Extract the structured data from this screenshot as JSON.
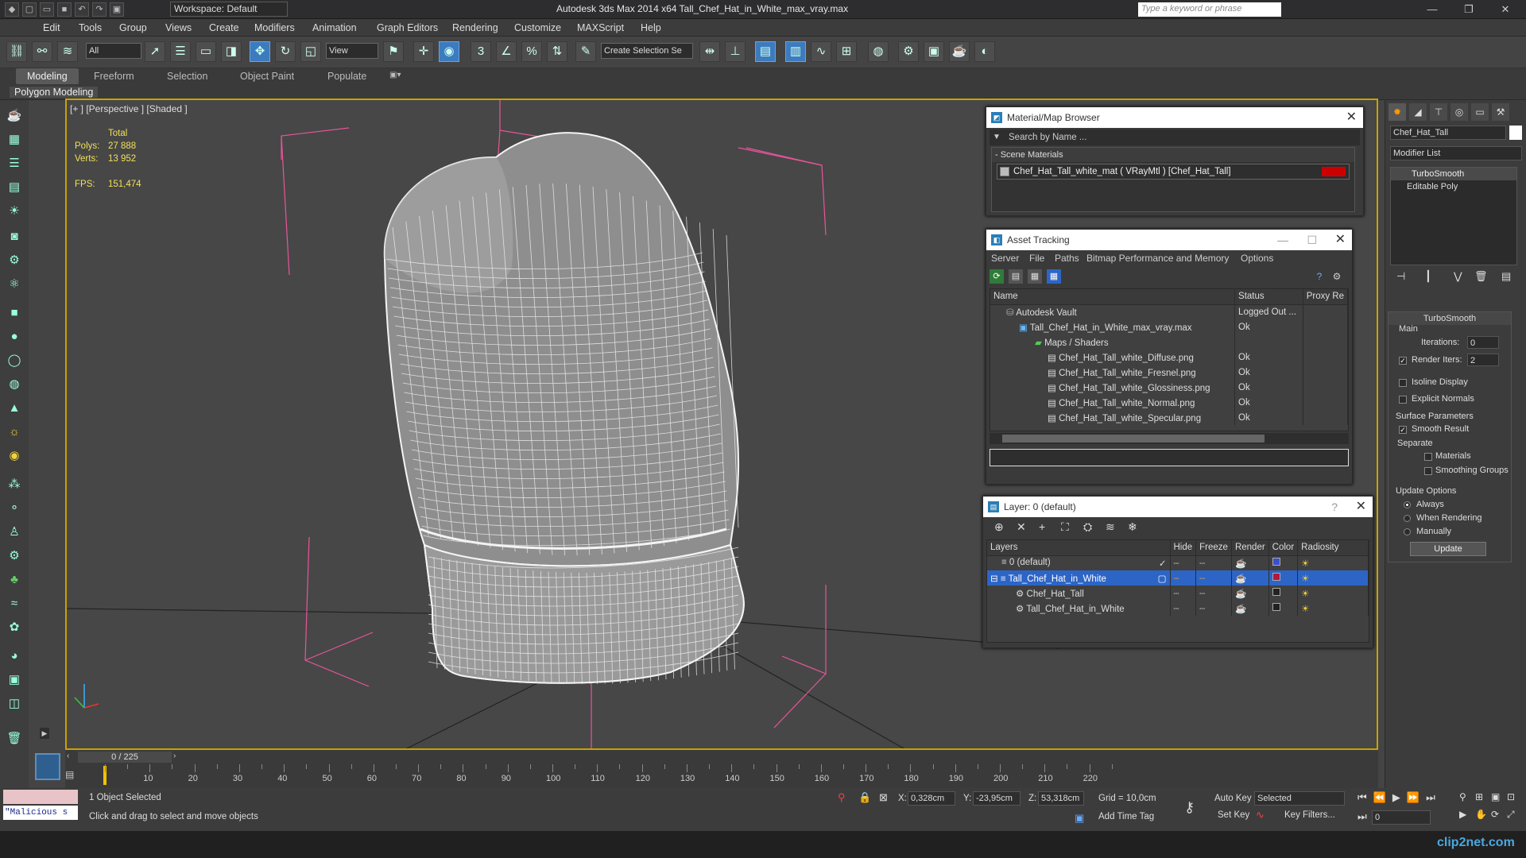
{
  "app": {
    "window_title": "Autodesk 3ds Max  2014 x64     Tall_Chef_Hat_in_White_max_vray.max",
    "workspace": "Workspace: Default",
    "search_placeholder": "Type a keyword or phrase"
  },
  "menu": [
    "Edit",
    "Tools",
    "Group",
    "Views",
    "Create",
    "Modifiers",
    "Animation",
    "Graph Editors",
    "Rendering",
    "Customize",
    "MAXScript",
    "Help"
  ],
  "toolbar": {
    "selection_filter": "All",
    "ref_coord": "View",
    "named_selection": "Create Selection Se"
  },
  "ribbon": {
    "tabs": [
      "Modeling",
      "Freeform",
      "Selection",
      "Object Paint",
      "Populate"
    ],
    "active": "Modeling",
    "sub": "Polygon Modeling"
  },
  "viewport": {
    "label": "[+ ] [Perspective ] [Shaded ]",
    "stats": {
      "total_label": "Total",
      "polys_label": "Polys:",
      "polys": "27 888",
      "verts_label": "Verts:",
      "verts": "13 952",
      "fps_label": "FPS:",
      "fps": "151,474"
    }
  },
  "material_browser": {
    "title": "Material/Map Browser",
    "search": "Search by Name ...",
    "section": "- Scene Materials",
    "material": "Chef_Hat_Tall_white_mat  ( VRayMtl )  [Chef_Hat_Tall]"
  },
  "asset_tracking": {
    "title": "Asset Tracking",
    "menu": [
      "Server",
      "File",
      "Paths",
      "Bitmap Performance and Memory",
      "Options"
    ],
    "columns": [
      "Name",
      "Status",
      "Proxy Re"
    ],
    "rows": [
      {
        "name": "Autodesk Vault",
        "status": "Logged Out ..."
      },
      {
        "name": "Tall_Chef_Hat_in_White_max_vray.max",
        "status": "Ok"
      },
      {
        "name": "Maps / Shaders",
        "status": ""
      },
      {
        "name": "Chef_Hat_Tall_white_Diffuse.png",
        "status": "Ok"
      },
      {
        "name": "Chef_Hat_Tall_white_Fresnel.png",
        "status": "Ok"
      },
      {
        "name": "Chef_Hat_Tall_white_Glossiness.png",
        "status": "Ok"
      },
      {
        "name": "Chef_Hat_Tall_white_Normal.png",
        "status": "Ok"
      },
      {
        "name": "Chef_Hat_Tall_white_Specular.png",
        "status": "Ok"
      }
    ]
  },
  "layer_manager": {
    "title": "Layer: 0 (default)",
    "help": "?",
    "columns": [
      "Layers",
      "Hide",
      "Freeze",
      "Render",
      "Color",
      "Radiosity"
    ],
    "rows": [
      {
        "name": "0 (default)",
        "color": "#3a4fd0"
      },
      {
        "name": "Tall_Chef_Hat_in_White",
        "color": "#b5173a"
      },
      {
        "name": "Chef_Hat_Tall",
        "color": "#222222"
      },
      {
        "name": "Tall_Chef_Hat_in_White",
        "color": "#222222"
      }
    ]
  },
  "command_panel": {
    "object_name": "Chef_Hat_Tall",
    "modifier_list": "Modifier List",
    "stack": [
      "TurboSmooth",
      "Editable Poly"
    ],
    "turbosmooth": {
      "header": "TurboSmooth",
      "main": "Main",
      "iterations_label": "Iterations:",
      "iterations": "0",
      "render_iters_label": "Render Iters:",
      "render_iters": "2",
      "isoline": "Isoline Display",
      "explicit": "Explicit Normals",
      "surface": "Surface Parameters",
      "smooth": "Smooth Result",
      "separate": "Separate",
      "materials": "Materials",
      "smoothing_groups": "Smoothing Groups",
      "update_options": "Update Options",
      "always": "Always",
      "when_rendering": "When Rendering",
      "manually": "Manually",
      "update_btn": "Update"
    }
  },
  "timeline": {
    "frame": "0 / 225",
    "ticks": [
      "10",
      "20",
      "30",
      "40",
      "50",
      "60",
      "70",
      "80",
      "90",
      "100",
      "110",
      "120",
      "130",
      "140",
      "150",
      "160",
      "170",
      "180",
      "190",
      "200",
      "210",
      "220"
    ]
  },
  "status": {
    "script": "\"Malicious s",
    "selected": "1 Object Selected",
    "prompt": "Click and drag to select and move objects",
    "x_label": "X:",
    "x": "0,328cm",
    "y_label": "Y:",
    "y": "-23,95cm",
    "z_label": "Z:",
    "z": "53,318cm",
    "grid": "Grid = 10,0cm",
    "auto_key": "Auto Key",
    "set_key": "Set Key",
    "selected_dd": "Selected",
    "key_filters": "Key Filters...",
    "add_time_tag": "Add Time Tag",
    "frame_field": "0",
    "watermark": "clip2net.com"
  }
}
